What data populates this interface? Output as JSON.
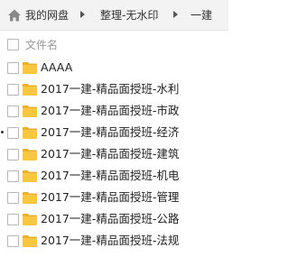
{
  "breadcrumb": {
    "items": [
      "我的网盘",
      "整理-无水印",
      "一建"
    ]
  },
  "list_header": {
    "column_label": "文件名"
  },
  "files": [
    {
      "name": "AAAA",
      "type": "folder"
    },
    {
      "name": "2017一建-精品面授班-水利",
      "type": "folder"
    },
    {
      "name": "2017一建-精品面授班-市政",
      "type": "folder"
    },
    {
      "name": "2017一建-精品面授班-经济",
      "type": "folder"
    },
    {
      "name": "2017一建-精品面授班-建筑",
      "type": "folder"
    },
    {
      "name": "2017一建-精品面授班-机电",
      "type": "folder"
    },
    {
      "name": "2017一建-精品面授班-管理",
      "type": "folder"
    },
    {
      "name": "2017一建-精品面授班-公路",
      "type": "folder"
    },
    {
      "name": "2017一建-精品面授班-法规",
      "type": "folder"
    }
  ],
  "colors": {
    "folder_fill": "#f7c742",
    "folder_tab": "#e9b12e",
    "breadcrumb_bg": "#f3f3f3",
    "header_text": "#9a9a9a"
  }
}
